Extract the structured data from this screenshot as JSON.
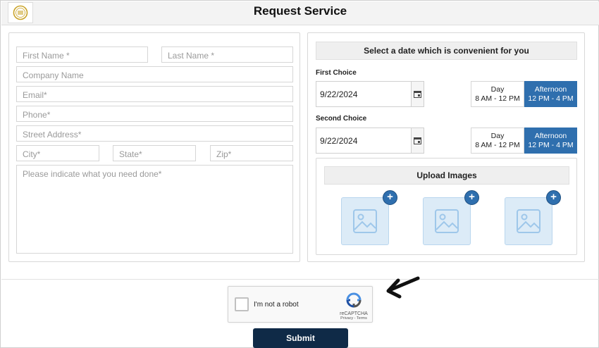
{
  "header": {
    "title": "Request Service"
  },
  "form": {
    "first_name_ph": "First Name *",
    "last_name_ph": "Last Name *",
    "company_ph": "Company Name",
    "email_ph": "Email*",
    "phone_ph": "Phone*",
    "street_ph": "Street Address*",
    "city_ph": "City*",
    "state_ph": "State*",
    "zip_ph": "Zip*",
    "details_ph": "Please indicate what you need done*"
  },
  "schedule": {
    "heading": "Select a date which is convenient for you",
    "first": {
      "label": "First Choice",
      "date": "9/22/2024",
      "day_title": "Day",
      "day_time": "8 AM - 12 PM",
      "aft_title": "Afternoon",
      "aft_time": "12 PM - 4 PM",
      "selected": "Afternoon"
    },
    "second": {
      "label": "Second Choice",
      "date": "9/22/2024",
      "day_title": "Day",
      "day_time": "8 AM - 12 PM",
      "aft_title": "Afternoon",
      "aft_time": "12 PM - 4 PM",
      "selected": "Afternoon"
    }
  },
  "upload": {
    "heading": "Upload Images",
    "plus": "+"
  },
  "recaptcha": {
    "label": "I'm not a robot",
    "brand": "reCAPTCHA",
    "links": "Privacy - Terms"
  },
  "submit_label": "Submit",
  "colors": {
    "accent": "#2f6fae",
    "submit": "#0f2a47",
    "logo": "#c9a227"
  },
  "icons": [
    "logo-icon",
    "calendar-icon",
    "image-placeholder-icon",
    "add-icon",
    "recaptcha-icon",
    "arrow-icon"
  ]
}
